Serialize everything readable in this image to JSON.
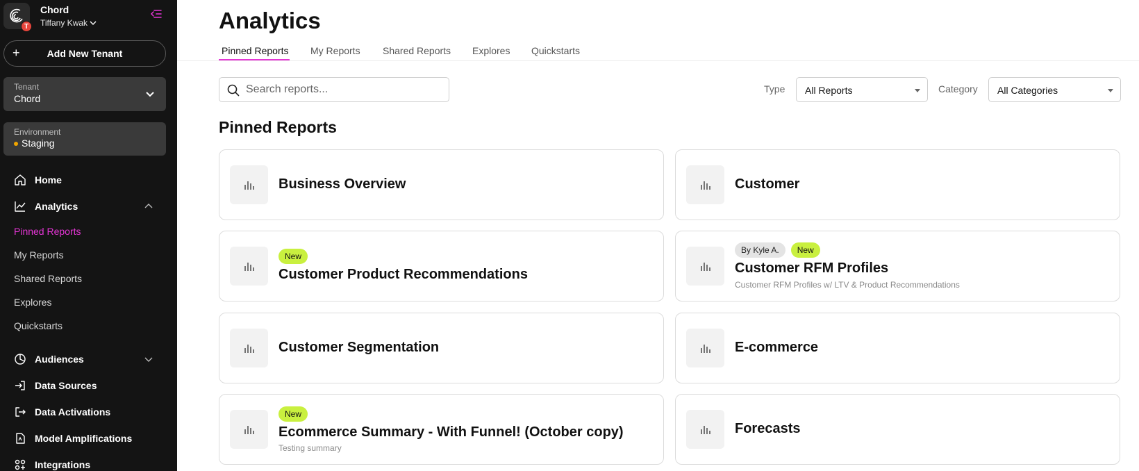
{
  "sidebar": {
    "org_name": "Chord",
    "user_name": "Tiffany Kwak",
    "avatar_initial": "T",
    "add_tenant_label": "Add New Tenant",
    "tenant": {
      "key": "Tenant",
      "value": "Chord"
    },
    "environment": {
      "key": "Environment",
      "value": "Staging"
    },
    "nav": {
      "home": "Home",
      "analytics": "Analytics",
      "audiences": "Audiences",
      "data_sources": "Data Sources",
      "data_activations": "Data Activations",
      "model_amplifications": "Model Amplifications",
      "integrations": "Integrations"
    },
    "analytics_sub": [
      "Pinned Reports",
      "My Reports",
      "Shared Reports",
      "Explores",
      "Quickstarts"
    ]
  },
  "main": {
    "title": "Analytics",
    "tabs": [
      "Pinned Reports",
      "My Reports",
      "Shared Reports",
      "Explores",
      "Quickstarts"
    ],
    "search_placeholder": "Search reports...",
    "filters": {
      "type_label": "Type",
      "type_value": "All Reports",
      "category_label": "Category",
      "category_value": "All Categories"
    },
    "section_title": "Pinned Reports",
    "cards": [
      {
        "title": "Business Overview"
      },
      {
        "title": "Customer"
      },
      {
        "title": "Customer Product Recommendations",
        "badge_new": "New"
      },
      {
        "title": "Customer RFM Profiles",
        "badge_author": "By Kyle A.",
        "badge_new": "New",
        "desc": "Customer RFM Profiles w/ LTV & Product Recommendations"
      },
      {
        "title": "Customer Segmentation"
      },
      {
        "title": "E-commerce"
      },
      {
        "title": "Ecommerce Summary - With Funnel! (October copy)",
        "badge_new": "New",
        "desc": "Testing summary"
      },
      {
        "title": "Forecasts"
      }
    ]
  },
  "colors": {
    "accent": "#e635d6",
    "new_badge": "#c9f03f",
    "sidebar_bg": "#141414",
    "staging_dot": "#f0a500"
  }
}
